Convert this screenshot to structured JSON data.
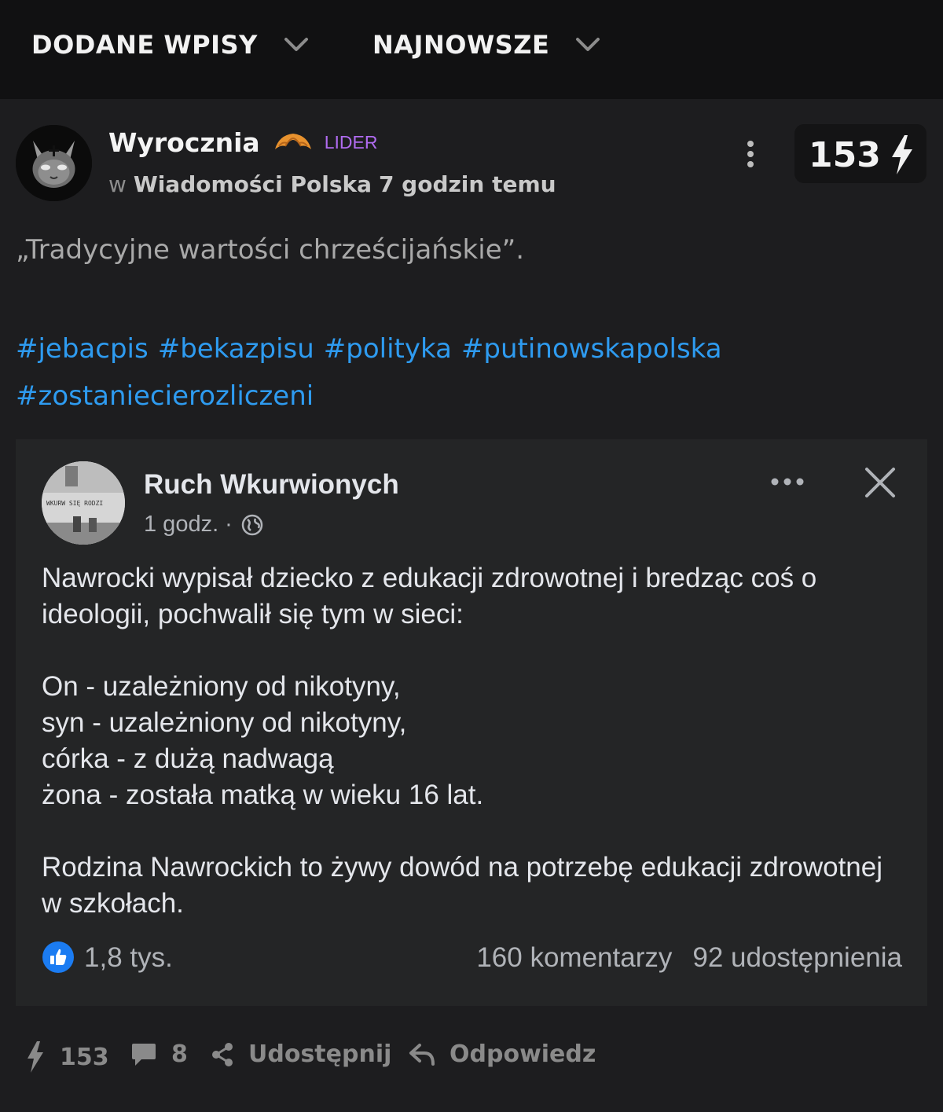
{
  "topbar": {
    "filter_label": "DODANE WPISY",
    "sort_label": "NAJNOWSZE"
  },
  "post": {
    "author": "Wyrocznia",
    "badge": "LIDER",
    "meta_prefix": "w",
    "community": "Wiadomości Polska",
    "time": "7 godzin temu",
    "votes": "153",
    "text": "„Tradycyjne wartości chrześcijańskie”.",
    "tags": [
      "#jebacpis",
      "#bekazpisu",
      "#polityka",
      "#putinowskapolska",
      "#zostaniecierozliczeni"
    ]
  },
  "embed": {
    "page_name": "Ruch Wkurwionych",
    "time": "1 godz. ·",
    "avatar_text": "WKURW SIĘ RODZI",
    "text": "Nawrocki wypisał dziecko z edukacji zdrowotnej i bredząc coś o ideologii, pochwalił się tym w sieci:\n\nOn - uzależniony od nikotyny,\nsyn - uzależniony od nikotyny,\ncórka - z dużą nadwagą\nżona - została matką w wieku 16 lat.\n\nRodzina Nawrockich to żywy dowód na potrzebę edukacji zdrowotnej w szkołach.",
    "likes": "1,8 tys.",
    "comments": "160 komentarzy",
    "shares": "92 udostępnienia"
  },
  "actions": {
    "votes": "153",
    "comments": "8",
    "share_label": "Udostępnij",
    "reply_label": "Odpowiedz"
  },
  "colors": {
    "background": "#1d1d1f",
    "topbar": "#111112",
    "hashtag": "#2e9bf0",
    "badge": "#b06bf0",
    "embed_bg": "#242526"
  }
}
